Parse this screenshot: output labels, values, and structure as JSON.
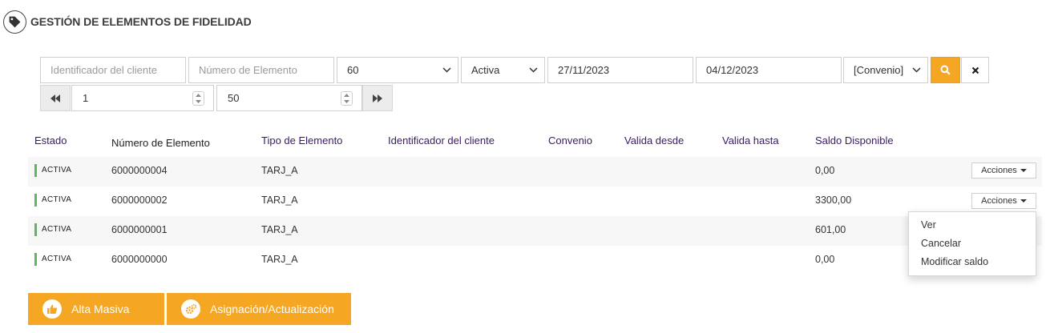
{
  "header": {
    "title": "GESTIÓN DE ELEMENTOS DE FIDELIDAD",
    "icon": "tag-icon"
  },
  "filters": {
    "client_id_placeholder": "Identificador del cliente",
    "element_number_placeholder": "Número de Elemento",
    "page_size": "60",
    "status": "Activa",
    "date_from": "27/11/2023",
    "date_to": "04/12/2023",
    "agreement": "[Convenio]"
  },
  "pagination": {
    "page": "1",
    "size": "50"
  },
  "table": {
    "headers": {
      "estado": "Estado",
      "numero": "Número de Elemento",
      "tipo": "Tipo de Elemento",
      "cliente": "Identificador del cliente",
      "convenio": "Convenio",
      "desde": "Valida desde",
      "hasta": "Valida hasta",
      "saldo": "Saldo Disponible"
    },
    "rows": [
      {
        "status": "ACTIVA",
        "number": "6000000004",
        "type": "TARJ_A",
        "balance": "0,00",
        "actions": "Acciones"
      },
      {
        "status": "ACTIVA",
        "number": "6000000002",
        "type": "TARJ_A",
        "balance": "3300,00",
        "actions": "Acciones"
      },
      {
        "status": "ACTIVA",
        "number": "6000000001",
        "type": "TARJ_A",
        "balance": "601,00"
      },
      {
        "status": "ACTIVA",
        "number": "6000000000",
        "type": "TARJ_A",
        "balance": "0,00"
      }
    ]
  },
  "actions_menu": {
    "items": [
      "Ver",
      "Cancelar",
      "Modificar saldo"
    ]
  },
  "bottom": {
    "mass_upload": "Alta Masiva",
    "assignment": "Asignación/Actualización"
  },
  "colors": {
    "accent": "#f5a623",
    "status_active": "#5cb85c",
    "header_text": "#3a1a66"
  }
}
